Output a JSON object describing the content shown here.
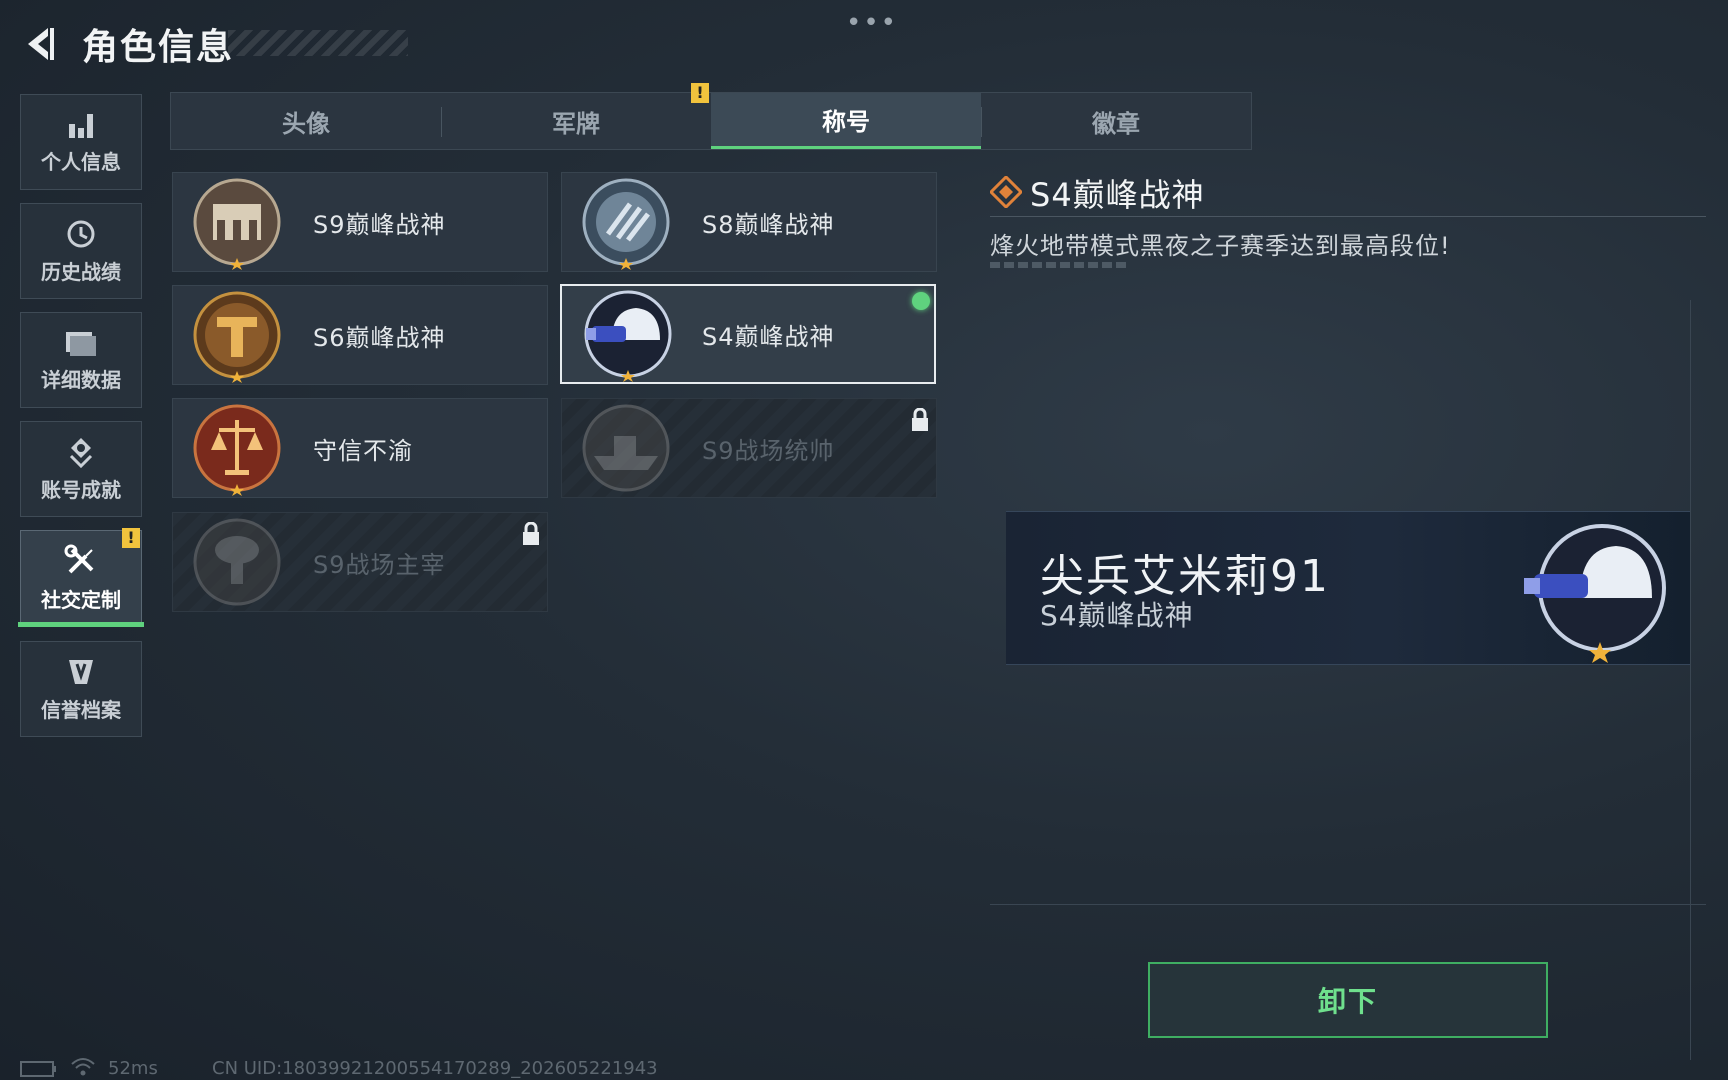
{
  "header": {
    "title": "角色信息",
    "more": "•••"
  },
  "sidebar": {
    "items": [
      {
        "label": "个人信息",
        "icon": "bar-chart-icon"
      },
      {
        "label": "历史战绩",
        "icon": "history-icon"
      },
      {
        "label": "详细数据",
        "icon": "folder-icon"
      },
      {
        "label": "账号成就",
        "icon": "achievement-icon"
      },
      {
        "label": "社交定制",
        "icon": "tools-icon",
        "active": true,
        "badge": "!"
      },
      {
        "label": "信誉档案",
        "icon": "shield-icon"
      }
    ]
  },
  "tabs": [
    {
      "label": "头像"
    },
    {
      "label": "军牌",
      "badge": "!"
    },
    {
      "label": "称号",
      "active": true
    },
    {
      "label": "徽章"
    }
  ],
  "titles": [
    {
      "name": "S9巅峰战神",
      "emblem": "fortress-emblem-icon",
      "locked": false
    },
    {
      "name": "S8巅峰战神",
      "emblem": "slash-emblem-icon",
      "locked": false
    },
    {
      "name": "S6巅峰战神",
      "emblem": "t-emblem-icon",
      "locked": false
    },
    {
      "name": "S4巅峰战神",
      "emblem": "helmet-emblem-icon",
      "locked": false,
      "selected": true,
      "equipped": true
    },
    {
      "name": "守信不渝",
      "emblem": "scales-emblem-icon",
      "locked": false
    },
    {
      "name": "S9战场统帅",
      "emblem": "warship-emblem-icon",
      "locked": true
    },
    {
      "name": "S9战场主宰",
      "emblem": "mushroom-cloud-emblem-icon",
      "locked": true
    }
  ],
  "detail": {
    "title": "S4巅峰战神",
    "description": "烽火地带模式黑夜之子赛季达到最高段位!"
  },
  "preview": {
    "player_name": "尖兵艾米莉91",
    "title": "S4巅峰战神"
  },
  "actions": {
    "unequip_label": "卸下"
  },
  "footer": {
    "ping": "52ms",
    "uid": "CN UID:1803992120055417​0289_202605221943"
  },
  "colors": {
    "accent_green": "#5fd27e",
    "warning_yellow": "#f1c33d",
    "emblem_orange": "#e0823a"
  }
}
